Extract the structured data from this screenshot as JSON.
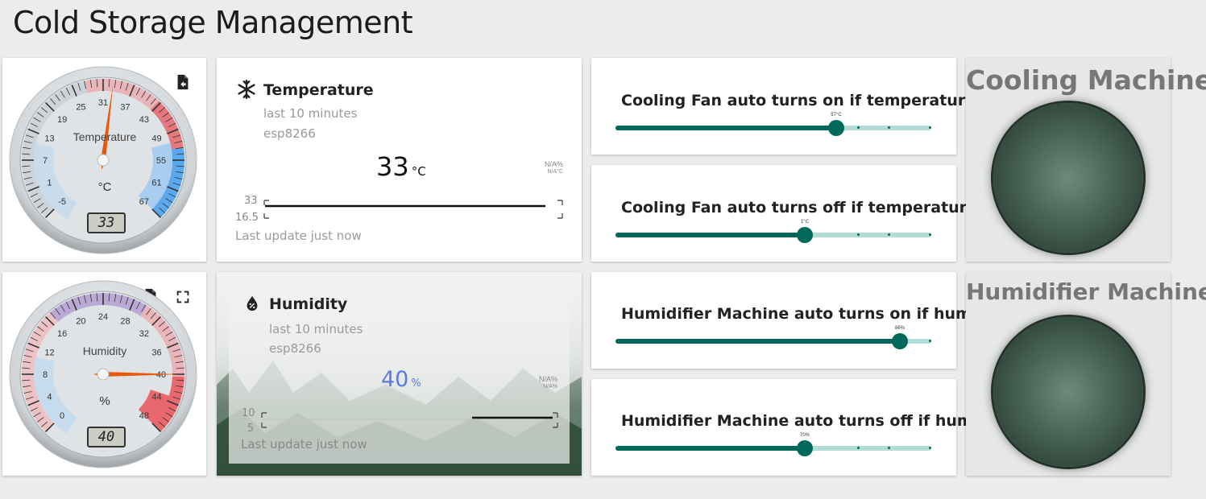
{
  "page": {
    "title": "Cold Storage Management"
  },
  "temp_gauge": {
    "label": "Temperature",
    "unit": "°C",
    "readout": "33",
    "value": 33,
    "ticks": [
      "-5",
      "1",
      "7",
      "13",
      "19",
      "25",
      "31",
      "37",
      "43",
      "49",
      "55",
      "61",
      "67"
    ]
  },
  "hum_gauge": {
    "label": "Humidity",
    "unit": "%",
    "readout": "40",
    "value": 40,
    "ticks": [
      "0",
      "4",
      "8",
      "12",
      "16",
      "20",
      "24",
      "28",
      "32",
      "36",
      "40",
      "44",
      "48"
    ]
  },
  "temp_card": {
    "title": "Temperature",
    "period": "last 10 minutes",
    "device": "esp8266",
    "value": "33",
    "unit": "°C",
    "na_1": "N/A%",
    "na_2": "N/A°C",
    "chart_max": "33",
    "chart_min": "16.5",
    "updated": "Last update just now",
    "colors": {
      "value": "#111111"
    }
  },
  "hum_card": {
    "title": "Humidity",
    "period": "last 10 minutes",
    "device": "esp8266",
    "value": "40",
    "unit": "%",
    "na_1": "N/A%",
    "na_2": "N/A%",
    "chart_max": "10",
    "chart_min": "5",
    "updated": "Last update just now",
    "colors": {
      "value": "#5e7be0"
    }
  },
  "sliders": [
    {
      "title": "Cooling Fan auto turns on if temperature ...",
      "value_label": "57°C",
      "fraction": 0.7
    },
    {
      "title": "Cooling Fan auto turns off if temperature ...",
      "value_label": "1°C",
      "fraction": 0.6
    },
    {
      "title": "Humidifier Machine auto turns on if humi...",
      "value_label": "86%",
      "fraction": 0.9
    },
    {
      "title": "Humidifier Machine auto turns off if humi...",
      "value_label": "70%",
      "fraction": 0.6
    }
  ],
  "machines": [
    {
      "title": "Cooling Machine",
      "state": "off"
    },
    {
      "title": "Humidifier Machine",
      "state": "off"
    }
  ],
  "colors": {
    "accent": "#00695c",
    "track": "#b2ddd6"
  }
}
